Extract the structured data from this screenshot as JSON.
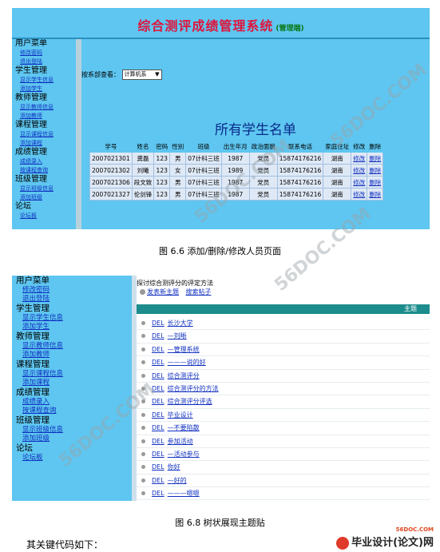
{
  "fig1": {
    "system_title": "综合测评成绩管理系统",
    "system_sub": "(管理端)",
    "sidebar": [
      {
        "type": "head",
        "label": "用户菜单"
      },
      {
        "type": "link",
        "label": "修改密码"
      },
      {
        "type": "link",
        "label": "退出登陆"
      },
      {
        "type": "head",
        "label": "学生管理"
      },
      {
        "type": "link",
        "label": "显示学生信息"
      },
      {
        "type": "link",
        "label": "添加学生"
      },
      {
        "type": "head",
        "label": "教师管理"
      },
      {
        "type": "link",
        "label": "显示教师信息"
      },
      {
        "type": "link",
        "label": "添加教师"
      },
      {
        "type": "head",
        "label": "课程管理"
      },
      {
        "type": "link",
        "label": "显示课程信息"
      },
      {
        "type": "link",
        "label": "添加课程"
      },
      {
        "type": "head",
        "label": "成绩管理"
      },
      {
        "type": "link",
        "label": "成绩录入"
      },
      {
        "type": "link",
        "label": "按课程查询"
      },
      {
        "type": "head",
        "label": "班级管理"
      },
      {
        "type": "link",
        "label": "显示班级信息"
      },
      {
        "type": "link",
        "label": "添加班级"
      },
      {
        "type": "head",
        "label": "论坛"
      },
      {
        "type": "link",
        "label": "论坛板"
      }
    ],
    "filter_label": "按系部查看：",
    "filter_value": "计算机系",
    "list_title": "所有学生名单",
    "columns": [
      "学号",
      "姓名",
      "密码",
      "性别",
      "班级",
      "出生年月",
      "政治面貌",
      "联系电话",
      "家庭住址",
      "修改",
      "删除"
    ],
    "rows": [
      [
        "2007021301",
        "龚磊",
        "123",
        "男",
        "07计科三班",
        "1987",
        "党员",
        "15874176216",
        "湖南",
        "修改",
        "删除"
      ],
      [
        "2007021302",
        "刘曦",
        "123",
        "女",
        "07计科三班",
        "1989",
        "党员",
        "15874176216",
        "湖南",
        "修改",
        "删除"
      ],
      [
        "2007021306",
        "段文致",
        "123",
        "男",
        "07计科三班",
        "1987",
        "党员",
        "15874176216",
        "湖南",
        "修改",
        "删除"
      ],
      [
        "2007021327",
        "伦剑锋",
        "123",
        "男",
        "07计科三班",
        "1987",
        "党员",
        "15874176216",
        "湖南",
        "修改",
        "删除"
      ]
    ]
  },
  "caption1": "图 6.6 添加/删除/修改人员页面",
  "fig2": {
    "sidebar": [
      {
        "type": "head",
        "label": "用户菜单"
      },
      {
        "type": "link",
        "label": "修改密码"
      },
      {
        "type": "link",
        "label": "退出登陆"
      },
      {
        "type": "head",
        "label": "学生管理"
      },
      {
        "type": "link",
        "label": "显示学生信息"
      },
      {
        "type": "link",
        "label": "添加学生"
      },
      {
        "type": "head",
        "label": "教师管理"
      },
      {
        "type": "link",
        "label": "显示教师信息"
      },
      {
        "type": "link",
        "label": "添加教师"
      },
      {
        "type": "head",
        "label": "课程管理"
      },
      {
        "type": "link",
        "label": "显示课程信息"
      },
      {
        "type": "link",
        "label": "添加课程"
      },
      {
        "type": "head",
        "label": "成绩管理"
      },
      {
        "type": "link",
        "label": "成绩录入"
      },
      {
        "type": "link",
        "label": "按课程查询"
      },
      {
        "type": "head",
        "label": "班级管理"
      },
      {
        "type": "link",
        "label": "显示班级信息"
      },
      {
        "type": "link",
        "label": "添加班级"
      },
      {
        "type": "head",
        "label": "论坛"
      },
      {
        "type": "link",
        "label": "论坛板"
      }
    ],
    "topic_title": "探讨综合测评分的评定方法",
    "new_topic": "发表新主题",
    "search_posts": "搜索帖子",
    "header_label": "主题",
    "del_label": "DEL",
    "topics": [
      "长沙大学",
      "—刘晰",
      "—管理系统",
      "———说的好",
      "综合测评分",
      "综合测评分的方法",
      "综合测评分评选",
      "毕业设计",
      "—不要陷散",
      "参加活动",
      "—活动参与",
      "你好",
      "—好的",
      "———嗯嗯"
    ]
  },
  "caption2": "图 6.8 树状展现主题贴",
  "footer_text": "其关键代码如下：",
  "logo": {
    "url": "56DOC.COM",
    "name": "毕业设计(论文)网"
  },
  "watermark": "56DOC.COM"
}
